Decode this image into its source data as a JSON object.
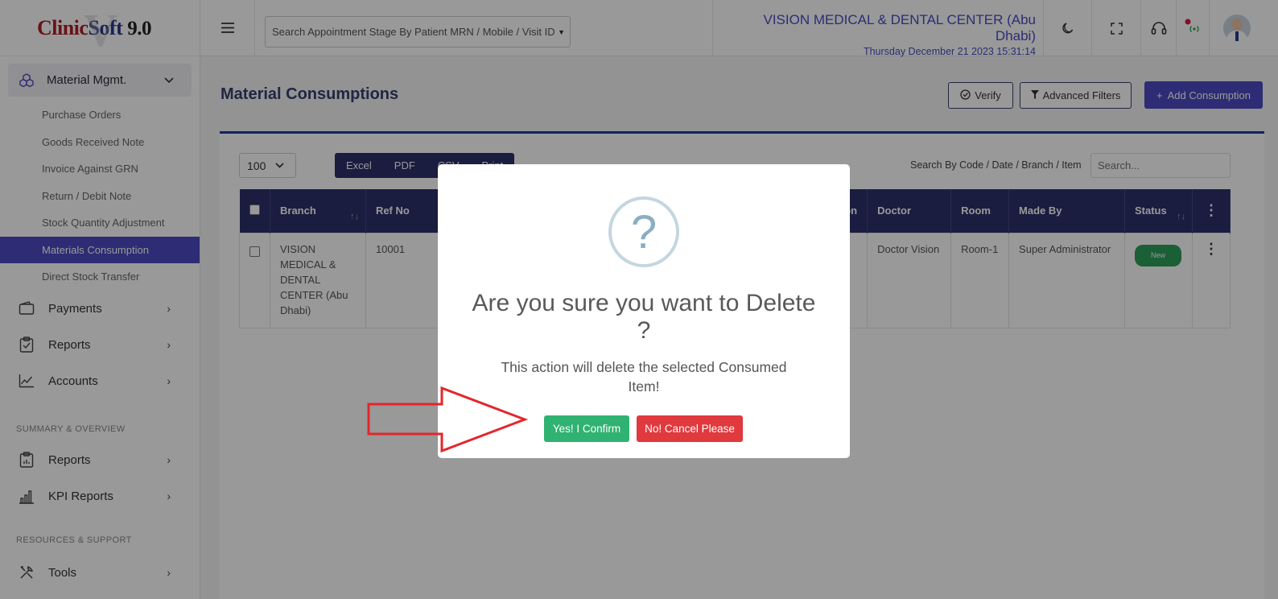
{
  "app": {
    "logo_clinic": "Clinic",
    "logo_soft": "Soft",
    "logo_version": "9.0"
  },
  "sidebar": {
    "group": {
      "label": "Material Mgmt.",
      "icon": "boxes-icon"
    },
    "sub_items": [
      {
        "label": "Purchase Orders",
        "active": false
      },
      {
        "label": "Goods Received Note",
        "active": false
      },
      {
        "label": "Invoice Against GRN",
        "active": false
      },
      {
        "label": "Return / Debit Note",
        "active": false
      },
      {
        "label": "Stock Quantity Adjustment",
        "active": false
      },
      {
        "label": "Materials Consumption",
        "active": true
      },
      {
        "label": "Direct Stock Transfer",
        "active": false
      }
    ],
    "items": [
      {
        "label": "Payments",
        "icon": "wallet-icon"
      },
      {
        "label": "Reports",
        "icon": "clipboard-check-icon"
      },
      {
        "label": "Accounts",
        "icon": "line-chart-icon"
      }
    ],
    "section_summary": "SUMMARY & OVERVIEW",
    "summary_items": [
      {
        "label": "Reports",
        "icon": "clipboard-chart-icon"
      },
      {
        "label": "KPI Reports",
        "icon": "bar-chart-icon"
      }
    ],
    "section_resources": "RESOURCES & SUPPORT",
    "resource_items": [
      {
        "label": "Tools",
        "icon": "tools-icon"
      }
    ]
  },
  "header": {
    "search_placeholder": "Search Appointment Stage By Patient MRN / Mobile / Visit ID",
    "clinic_name": "VISION MEDICAL & DENTAL CENTER (Abu Dhabi)",
    "datetime": "Thursday December 21 2023 15:31:14"
  },
  "page": {
    "title": "Material Consumptions",
    "verify_label": "Verify",
    "filters_label": "Advanced Filters",
    "add_label": "Add Consumption"
  },
  "table_controls": {
    "page_size": "100",
    "export_buttons": [
      "Excel",
      "PDF",
      "CSV",
      "Print"
    ],
    "search_label": "Search By Code / Date / Branch / Item",
    "search_placeholder": "Search..."
  },
  "table": {
    "columns": [
      "Branch",
      "Ref No",
      "",
      "tion",
      "Doctor",
      "Room",
      "Made By",
      "Status"
    ],
    "rows": [
      {
        "branch": "VISION MEDICAL & DENTAL CENTER (Abu Dhabi)",
        "ref_no": "10001",
        "doctor": "Doctor Vision",
        "room": "Room-1",
        "made_by": "Super Administrator",
        "status": "New"
      }
    ]
  },
  "modal": {
    "icon": "question-icon",
    "title": "Are you sure you want to Delete ?",
    "text": "This action will delete the selected Consumed Item!",
    "confirm_label": "Yes! I Confirm",
    "cancel_label": "No! Cancel Please"
  },
  "colors": {
    "primary": "#4b4ac2",
    "header_dark": "#2c2f6b",
    "confirm": "#30b272",
    "cancel": "#e0393e",
    "status_new": "#2e9e5b",
    "arrow": "#e3262b"
  }
}
